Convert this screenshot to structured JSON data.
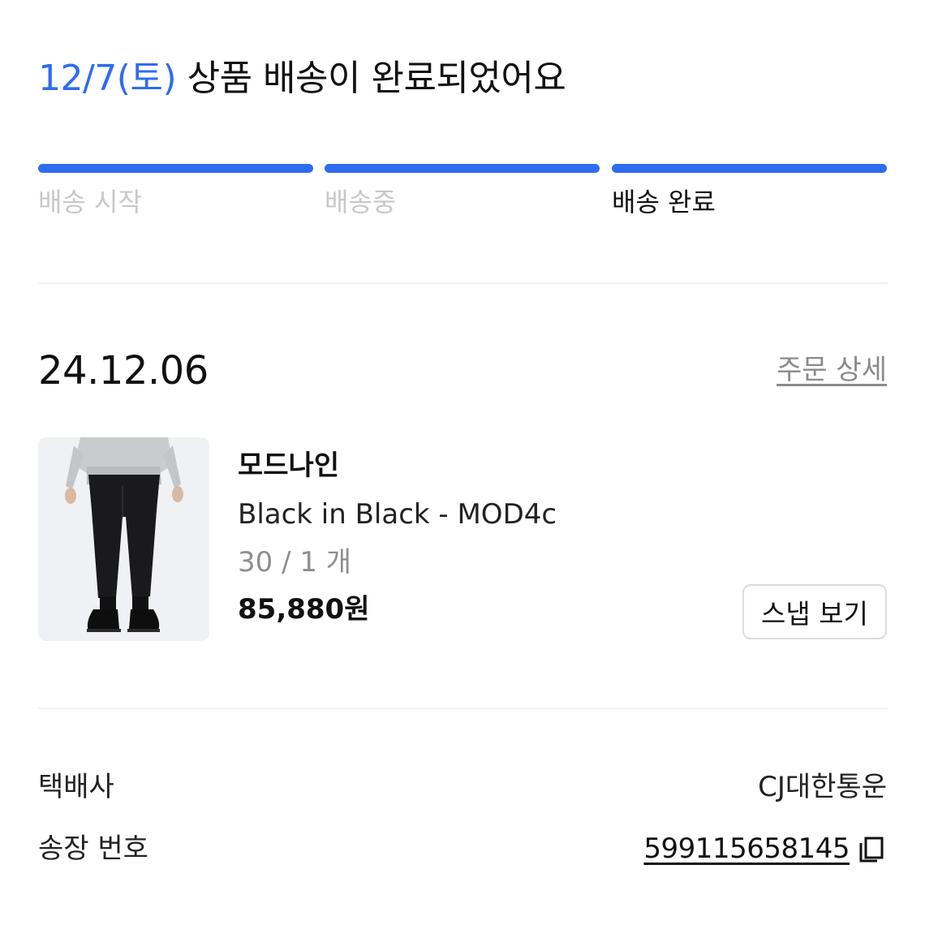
{
  "headline": {
    "date": "12/7(토)",
    "message": " 상품 배송이 완료되었어요"
  },
  "steps": [
    {
      "label": "배송 시작",
      "state": "done"
    },
    {
      "label": "배송중",
      "state": "done"
    },
    {
      "label": "배송 완료",
      "state": "current"
    }
  ],
  "order": {
    "date": "24.12.06",
    "detail_link": "주문 상세",
    "item": {
      "brand": "모드나인",
      "name": "Black in Black - MOD4c",
      "option": "30 / 1 개",
      "price": "85,880원",
      "snap_button": "스냅 보기"
    }
  },
  "shipping": {
    "courier_label": "택배사",
    "courier_value": "CJ대한통운",
    "tracking_label": "송장 번호",
    "tracking_value": "599115658145"
  },
  "colors": {
    "accent": "#2f6cf0",
    "muted": "#c8c8c8",
    "link": "#8a8a8a"
  },
  "icons": {
    "copy": "copy-icon"
  }
}
